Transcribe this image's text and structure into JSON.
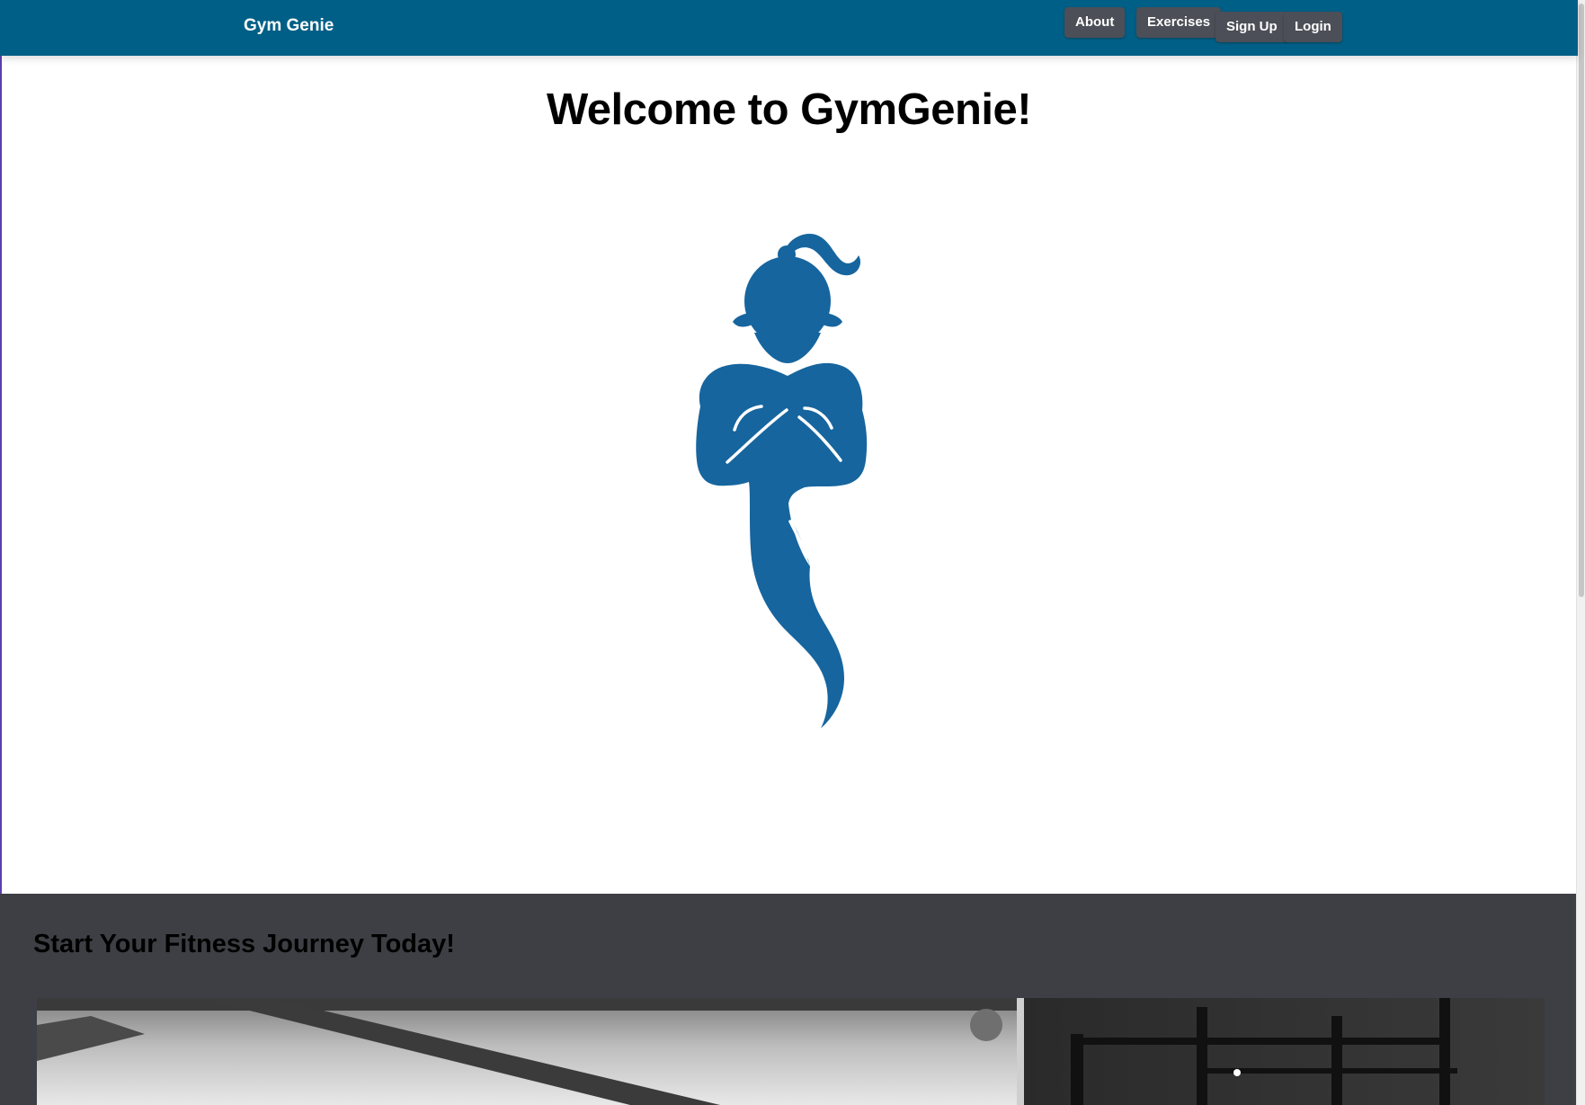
{
  "navbar": {
    "brand": "Gym Genie",
    "buttons": {
      "about": "About",
      "exercises": "Exercises",
      "signup": "Sign Up",
      "login": "Login"
    },
    "bg_color": "#005f86",
    "button_color": "#4c4f57"
  },
  "hero": {
    "title": "Welcome to GymGenie!",
    "logo_icon": "genie-logo",
    "logo_color": "#16659e"
  },
  "journey": {
    "title": "Start Your Fitness Journey Today!",
    "bg_color": "#3e3f44",
    "photo": "gym-photo-grayscale"
  }
}
